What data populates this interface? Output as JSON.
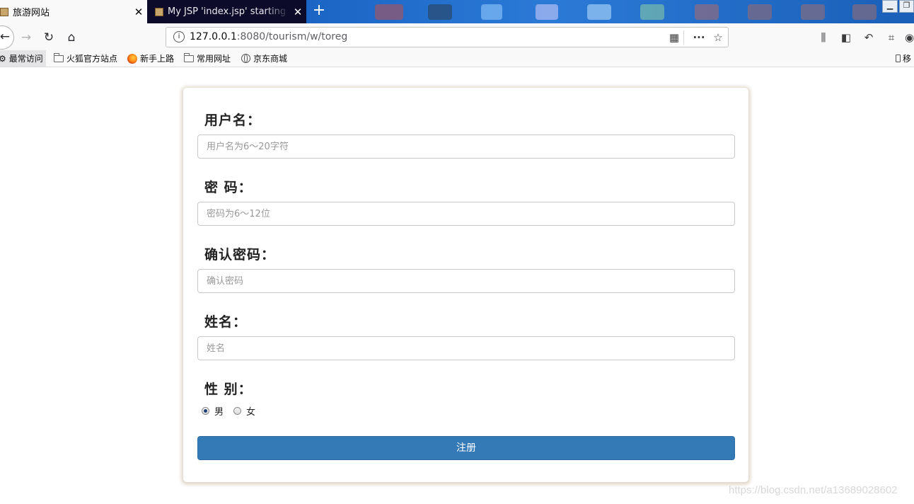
{
  "browser": {
    "tabs": [
      {
        "title": "旅游网站",
        "active": true
      },
      {
        "title": "My JSP 'index.jsp' starting page",
        "active": false
      }
    ],
    "new_tab_label": "+",
    "url": {
      "host": "127.0.0.1",
      "rest": ":8080/tourism/w/toreg"
    }
  },
  "bookmarks": [
    {
      "label": "最常访问",
      "icon": "gear-icon"
    },
    {
      "label": "火狐官方站点",
      "icon": "folder-icon"
    },
    {
      "label": "新手上路",
      "icon": "firefox-icon"
    },
    {
      "label": "常用网址",
      "icon": "folder-icon"
    },
    {
      "label": "京东商城",
      "icon": "globe-icon"
    }
  ],
  "mobile_bookmarks_label": "移",
  "form": {
    "username": {
      "label": "用户名：",
      "placeholder": "用户名为6～20字符"
    },
    "password": {
      "label": "密 码：",
      "placeholder": "密码为6～12位"
    },
    "confirm": {
      "label": "确认密码：",
      "placeholder": "确认密码"
    },
    "name": {
      "label": "姓名：",
      "placeholder": "姓名"
    },
    "gender": {
      "label": "性 别：",
      "options": [
        {
          "label": "男",
          "checked": true
        },
        {
          "label": "女",
          "checked": false
        }
      ]
    },
    "submit_label": "注册"
  },
  "watermark": "https://blog.csdn.net/a13689028602",
  "colors": {
    "primary_button": "#337ab7",
    "card_shadow": "#bea a8c"
  }
}
